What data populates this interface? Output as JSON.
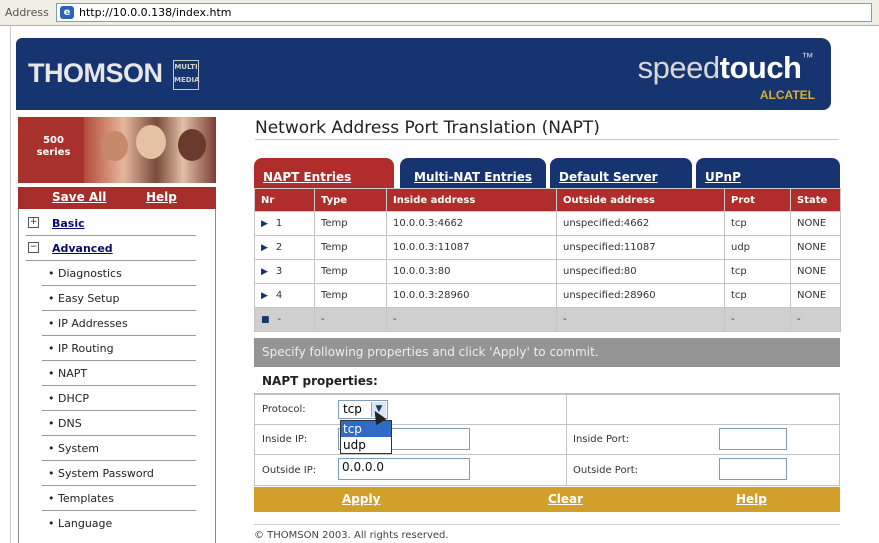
{
  "browser": {
    "address_label": "Address",
    "url": "http://10.0.0.138/index.htm"
  },
  "header": {
    "brand": "THOMSON",
    "brand_sub": "MULTI MEDIA",
    "product_light": "speed",
    "product_bold": "touch",
    "product_tm": "™",
    "vendor": "ALCATEL"
  },
  "sidebar": {
    "series": "500 series",
    "save_all": "Save All",
    "help": "Help",
    "items": [
      {
        "label": "Basic",
        "expander": "+"
      },
      {
        "label": "Advanced",
        "expander": "−"
      },
      {
        "label": "Diagnostics"
      },
      {
        "label": "Easy Setup"
      },
      {
        "label": "IP Addresses"
      },
      {
        "label": "IP Routing"
      },
      {
        "label": "NAPT"
      },
      {
        "label": "DHCP"
      },
      {
        "label": "DNS"
      },
      {
        "label": "System"
      },
      {
        "label": "System Password"
      },
      {
        "label": "Templates"
      },
      {
        "label": "Language"
      }
    ]
  },
  "main": {
    "title": "Network Address Port Translation (NAPT)",
    "tabs": [
      "NAPT Entries",
      "Multi-NAT Entries",
      "Default Server",
      "UPnP"
    ],
    "table": {
      "headers": [
        "Nr",
        "Type",
        "Inside address",
        "Outside address",
        "Prot",
        "State"
      ],
      "rows": [
        [
          "1",
          "Temp",
          "10.0.0.3:4662",
          "unspecified:4662",
          "tcp",
          "NONE"
        ],
        [
          "2",
          "Temp",
          "10.0.0.3:11087",
          "unspecified:11087",
          "udp",
          "NONE"
        ],
        [
          "3",
          "Temp",
          "10.0.0.3:80",
          "unspecified:80",
          "tcp",
          "NONE"
        ],
        [
          "4",
          "Temp",
          "10.0.0.3:28960",
          "unspecified:28960",
          "tcp",
          "NONE"
        ]
      ],
      "empty_row": [
        "-",
        "-",
        "-",
        "-",
        "-",
        "-"
      ]
    },
    "instruction": "Specify following properties and click 'Apply' to commit.",
    "properties_title": "NAPT properties:",
    "form": {
      "protocol_label": "Protocol:",
      "protocol_value": "tcp",
      "protocol_options": [
        "tcp",
        "udp"
      ],
      "inside_ip_label": "Inside IP:",
      "inside_ip_value": "",
      "outside_ip_label": "Outside IP:",
      "outside_ip_value": "0.0.0.0",
      "inside_port_label": "Inside Port:",
      "inside_port_value": "",
      "outside_port_label": "Outside Port:",
      "outside_port_value": ""
    },
    "actions": {
      "apply": "Apply",
      "clear": "Clear",
      "help": "Help"
    }
  },
  "footer": "© THOMSON 2003. All rights reserved.",
  "colors": {
    "navy": "#16346f",
    "red": "#b02d2b",
    "gold": "#d2a02a",
    "gray_bar": "#949494"
  }
}
